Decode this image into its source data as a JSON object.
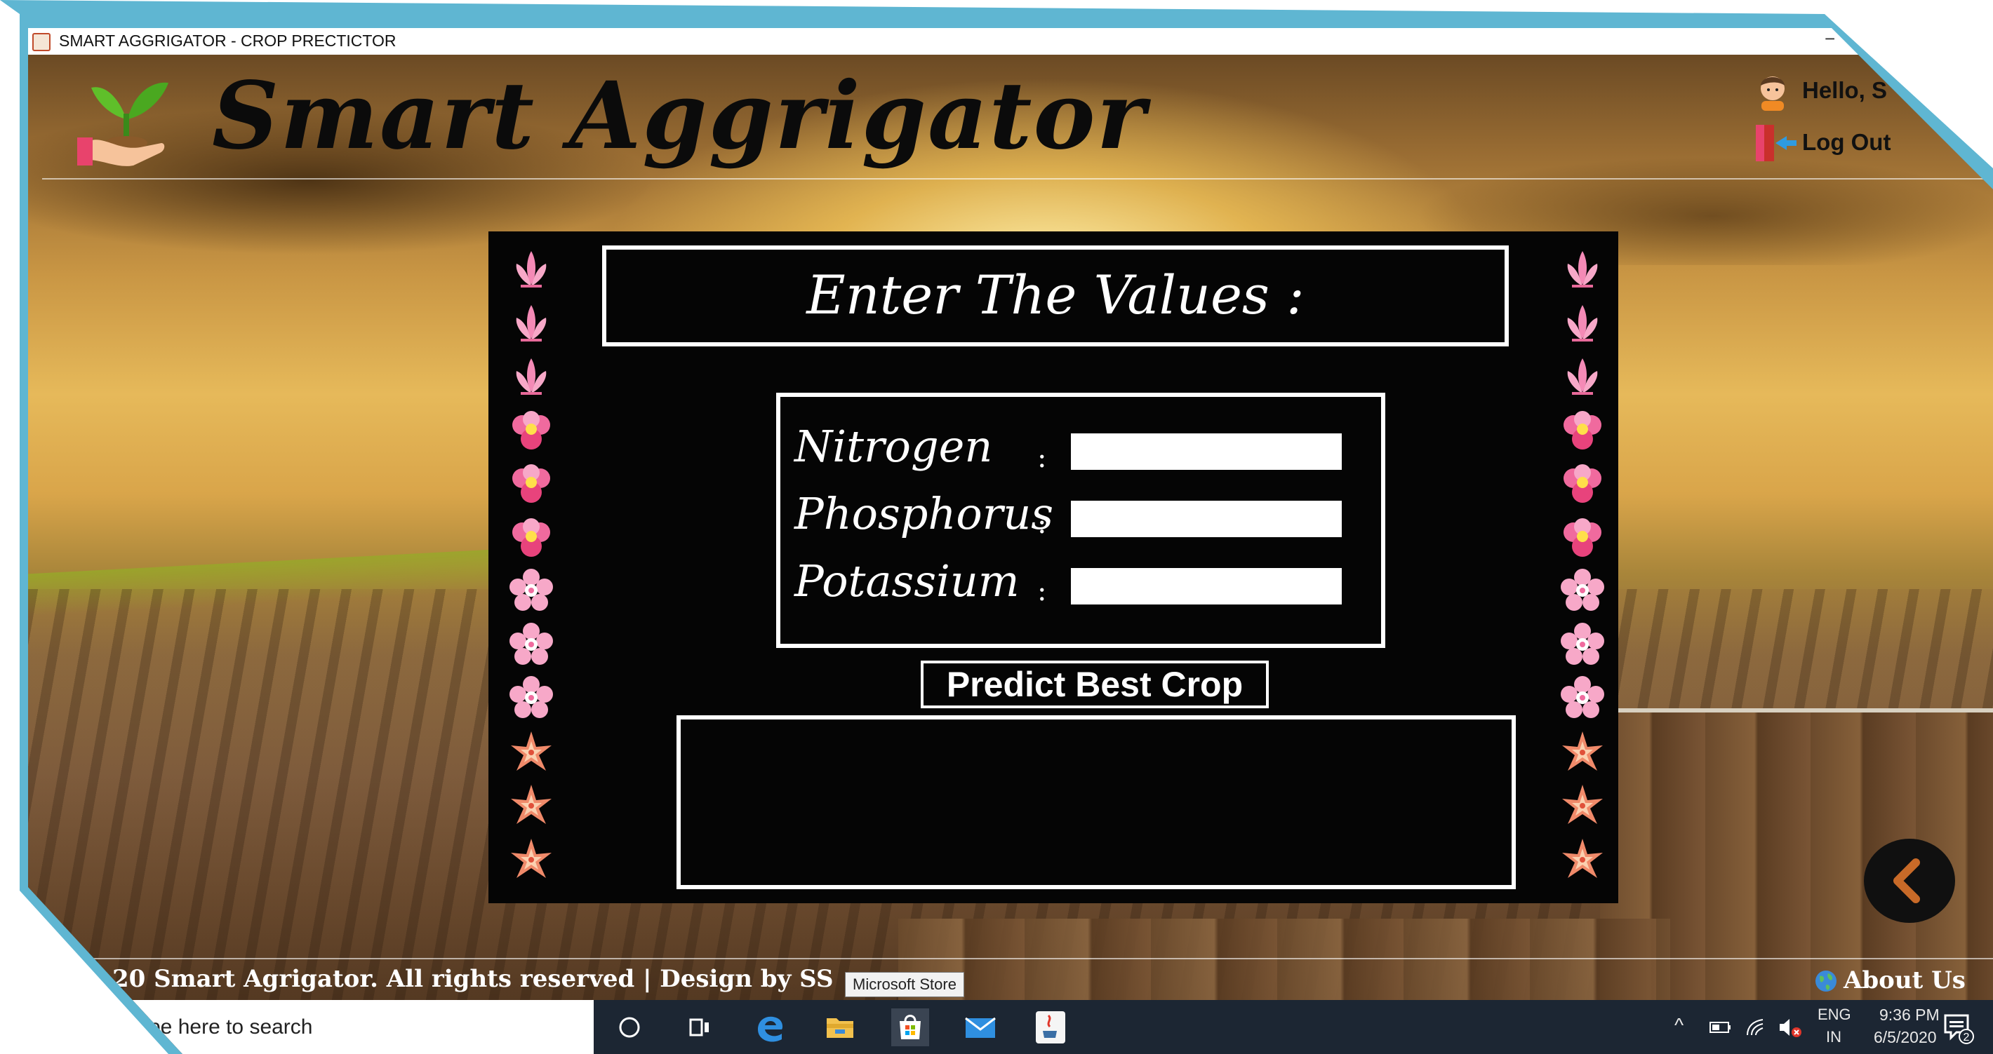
{
  "window": {
    "title": "SMART AGGRIGATOR - CROP PRECTICTOR",
    "minimize": "−"
  },
  "header": {
    "brand": "Smart Aggrigator",
    "greeting": "Hello, S",
    "logout_label": "Log Out"
  },
  "form": {
    "heading": "Enter The Values :",
    "fields": [
      {
        "label": "Nitrogen",
        "colon": ":",
        "value": ""
      },
      {
        "label": "Phosphorus",
        "colon": ":",
        "value": ""
      },
      {
        "label": "Potassium",
        "colon": ":",
        "value": ""
      }
    ],
    "predict_label": "Predict Best Crop",
    "result": ""
  },
  "footer": {
    "copyright": "20 Smart Agrigator. All rights reserved | Design by SS",
    "about_label": "About Us"
  },
  "tooltip": "Microsoft Store",
  "taskbar": {
    "search_text": "pe here to search",
    "language": "ENG",
    "region": "IN",
    "time": "9:36 PM",
    "date": "6/5/2020",
    "notification_count": "2"
  },
  "colors": {
    "panel": "#050505",
    "frame": "#5fb6d2",
    "taskbar": "#1c2633"
  },
  "icons": {
    "flowers": [
      "lotus-icon",
      "lotus-icon",
      "lotus-icon",
      "pink-flower-icon",
      "pink-flower-icon",
      "pink-flower-icon",
      "blossom-icon",
      "blossom-icon",
      "blossom-icon",
      "star-flower-icon",
      "star-flower-icon",
      "star-flower-icon"
    ]
  }
}
